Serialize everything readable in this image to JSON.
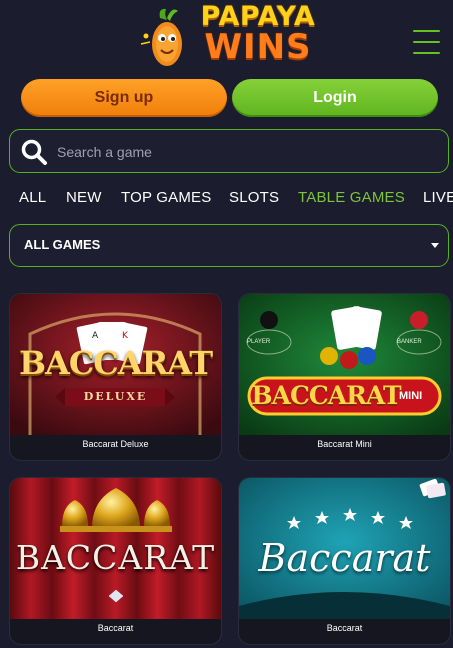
{
  "header": {
    "logo": {
      "line1": "PAPAYA",
      "line2": "WINS",
      "alt": "Papaya Wins logo"
    }
  },
  "auth": {
    "signup_label": "Sign up",
    "login_label": "Login"
  },
  "search": {
    "placeholder": "Search a game",
    "value": ""
  },
  "tabs": [
    {
      "label": "ALL",
      "active": false
    },
    {
      "label": "NEW",
      "active": false
    },
    {
      "label": "TOP GAMES",
      "active": false
    },
    {
      "label": "SLOTS",
      "active": false
    },
    {
      "label": "TABLE GAMES",
      "active": true
    },
    {
      "label": "LIVE",
      "active": false
    }
  ],
  "filter": {
    "selected": "ALL GAMES"
  },
  "games": [
    {
      "title": "Baccarat Deluxe",
      "art_main": "BACCARAT",
      "art_sub": "DELUXE"
    },
    {
      "title": "Baccarat Mini",
      "art_main": "BACCARAT",
      "art_sub": "MINI",
      "art_player": "PLAYER",
      "art_banker": "BANKER"
    },
    {
      "title": "Baccarat",
      "art_main": "BACCARAT"
    },
    {
      "title": "Baccarat",
      "art_main": "Baccarat"
    }
  ],
  "colors": {
    "background": "#1b1d2e",
    "accent_green": "#57b022",
    "active_tab": "#7cc43a",
    "signup_orange": "#f58a12",
    "login_green": "#6cbf26"
  }
}
